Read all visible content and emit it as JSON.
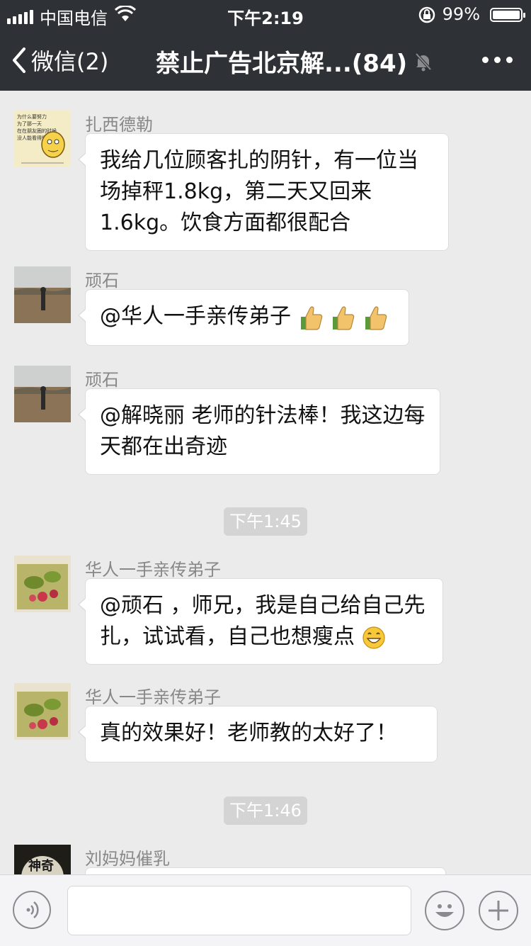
{
  "status_bar": {
    "carrier": "中国电信",
    "time": "下午2:19",
    "battery_pct": "99%",
    "battery_level": 0.99
  },
  "nav": {
    "back_label": "微信(2)",
    "title": "禁止广告北京解...(84)"
  },
  "messages": [
    {
      "sender": "扎西德勒",
      "text": "我给几位顾客扎的阴针，有一位当场掉秤1.8kg，第二天又回来1.6kg。饮食方面都很配合",
      "avatar_lines": [
        "为什么要努力",
        "为了那一天",
        "在在朋友圈的时候",
        "没人能看得懂"
      ]
    },
    {
      "sender": "顽石",
      "text": "@华人一手亲传弟子 "
    },
    {
      "sender": "顽石",
      "text": "@解晓丽 老师的针法棒！我这边每天都在出奇迹"
    },
    {
      "sender": "华人一手亲传弟子",
      "text": "@顽石 ，师兄，我是自己给自己先扎，试试看，自己也想瘦点"
    },
    {
      "sender": "华人一手亲传弟子",
      "text": "真的效果好！老师教的太好了！"
    },
    {
      "sender": "刘妈妈催乳",
      "avatar_text": "神奇"
    }
  ],
  "timestamps": [
    "下午1:45",
    "下午1:46"
  ],
  "colors": {
    "header_bg": "#2e3135",
    "chat_bg": "#ebebeb",
    "bubble_bg": "#ffffff",
    "meta_text": "#888888"
  },
  "icons": [
    "back-chevron-icon",
    "mute-bell-icon",
    "more-icon",
    "voice-icon",
    "emoji-icon",
    "plus-icon",
    "thumbs-up-icon",
    "grin-emoji-icon"
  ]
}
